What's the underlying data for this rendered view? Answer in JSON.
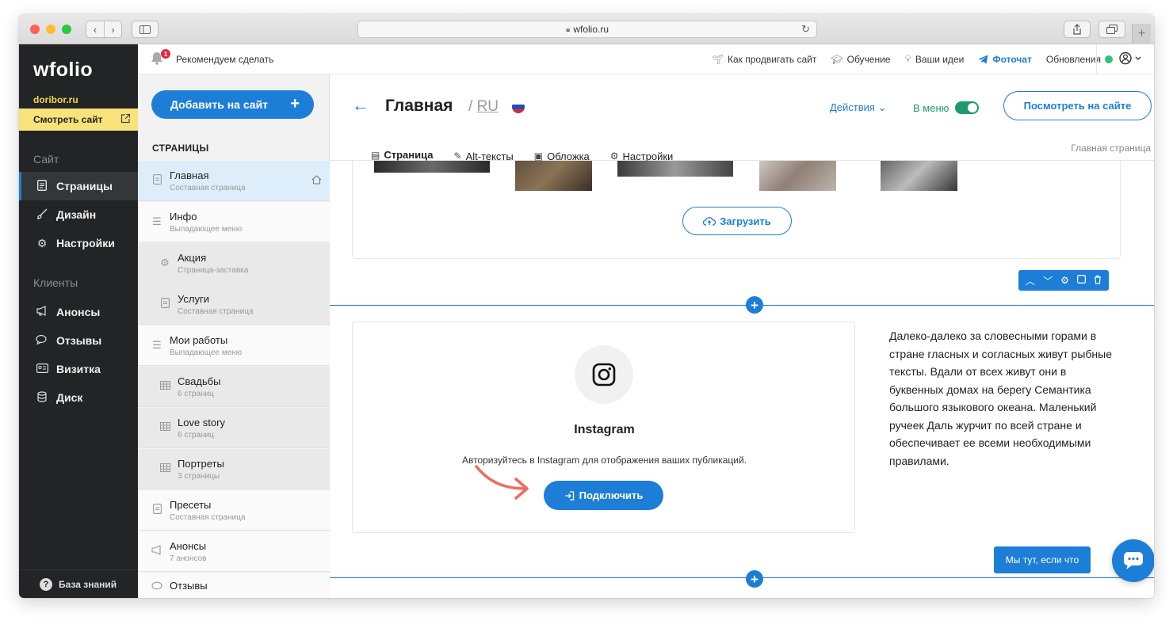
{
  "browser": {
    "url": "wfolio.ru",
    "traffic_lights": [
      "#fe5f57",
      "#febc2e",
      "#28c840"
    ]
  },
  "brand": {
    "logo": "wfolio",
    "domain": "doribor.ru",
    "view_site_label": "Смотреть сайт",
    "accent": "#1d7ed8",
    "highlight": "#f7e37a"
  },
  "leftnav": {
    "section_site": "Сайт",
    "section_clients": "Клиенты",
    "items_site": [
      {
        "label": "Страницы",
        "icon": "document-icon"
      },
      {
        "label": "Дизайн",
        "icon": "brush-icon"
      },
      {
        "label": "Настройки",
        "icon": "gear-icon"
      }
    ],
    "items_clients": [
      {
        "label": "Анонсы",
        "icon": "megaphone-icon"
      },
      {
        "label": "Отзывы",
        "icon": "chat-bubbles-icon"
      },
      {
        "label": "Визитка",
        "icon": "id-card-icon"
      },
      {
        "label": "Диск",
        "icon": "database-icon"
      }
    ],
    "knowledge_base": "База знаний"
  },
  "topbar": {
    "notification_count": "1",
    "recommend": "Рекомендуем сделать",
    "links": [
      {
        "label": "Как продвигать сайт",
        "icon": "sprout-icon"
      },
      {
        "label": "Обучение",
        "icon": "graduation-cap-icon"
      },
      {
        "label": "Ваши идеи",
        "icon": "lightbulb-icon"
      },
      {
        "label": "Фоточат",
        "icon": "telegram-icon"
      },
      {
        "label": "Обновления",
        "icon": "status-dot-icon"
      }
    ]
  },
  "pages": {
    "add_button": "Добавить на сайт",
    "title": "СТРАНИЦЫ",
    "items": [
      {
        "name": "Главная",
        "subtitle": "Составная страница",
        "icon": "document-icon",
        "level": 0,
        "active": true
      },
      {
        "name": "Инфо",
        "subtitle": "Выпадающее меню",
        "icon": "menu-icon",
        "level": 0
      },
      {
        "name": "Акция",
        "subtitle": "Страница-заставка",
        "icon": "gear-icon",
        "level": 1
      },
      {
        "name": "Услуги",
        "subtitle": "Составная страница",
        "icon": "document-icon",
        "level": 1
      },
      {
        "name": "Мои работы",
        "subtitle": "Выпадающее меню",
        "icon": "menu-icon",
        "level": 0
      },
      {
        "name": "Свадьбы",
        "subtitle": "6 страниц",
        "icon": "grid-icon",
        "level": 1
      },
      {
        "name": "Love story",
        "subtitle": "6 страниц",
        "icon": "grid-icon",
        "level": 1
      },
      {
        "name": "Портреты",
        "subtitle": "3 страницы",
        "icon": "grid-icon",
        "level": 1
      },
      {
        "name": "Пресеты",
        "subtitle": "Составная страница",
        "icon": "document-icon",
        "level": 0
      },
      {
        "name": "Анонсы",
        "subtitle": "7 анонсов",
        "icon": "megaphone-icon",
        "level": 0
      },
      {
        "name": "Отзывы",
        "subtitle": "",
        "icon": "chat-bubbles-icon",
        "level": 0
      }
    ]
  },
  "editor": {
    "page_title": "Главная",
    "lang_sep": "/",
    "lang": "RU",
    "actions": "Действия",
    "in_menu": "В меню",
    "view_button": "Посмотреть на сайте",
    "page_label": "Главная страница",
    "tabs": [
      {
        "label": "Страница",
        "icon": "document-icon"
      },
      {
        "label": "Alt-тексты",
        "icon": "edit-icon"
      },
      {
        "label": "Обложка",
        "icon": "image-icon"
      },
      {
        "label": "Настройки",
        "icon": "gear-icon"
      }
    ]
  },
  "gallery": {
    "upload_label": "Загрузить"
  },
  "instagram": {
    "title": "Instagram",
    "description": "Авторизуйтесь в Instagram для отображения ваших публикаций.",
    "connect_label": "Подключить"
  },
  "side_text": "Далеко-далеко за словесными горами в стране гласных и согласных живут рыбные тексты. Вдали от всех живут они в буквенных домах на берегу Семантика большого языкового океана. Маленький ручеек Даль журчит по всей стране и обеспечивает ее всеми необходимыми правилами.",
  "chat": {
    "help_label": "Мы тут, если что"
  }
}
